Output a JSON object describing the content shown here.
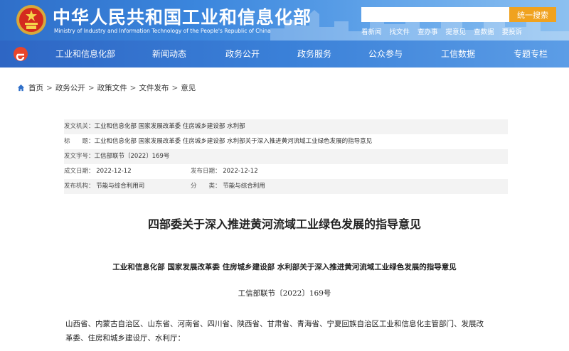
{
  "header": {
    "title": "中华人民共和国工业和信息化部",
    "subtitle": "Ministry of Industry and Information Technology of the People's Republic of China",
    "search_placeholder": "",
    "search_button": "统一搜索",
    "quick_links": [
      "看新闻",
      "找文件",
      "查办事",
      "提意见",
      "查数据",
      "要投诉"
    ]
  },
  "nav": {
    "items": [
      "工业和信息化部",
      "新闻动态",
      "政务公开",
      "政务服务",
      "公众参与",
      "工信数据",
      "专题专栏"
    ]
  },
  "breadcrumb": {
    "items": [
      "首页",
      "政务公开",
      "政策文件",
      "文件发布",
      "意见"
    ],
    "separator": ">"
  },
  "meta": {
    "issuer_label": "发文机关：",
    "issuer": "工业和信息化部 国家发展改革委 住房城乡建设部 水利部",
    "title_label": "标　　题：",
    "title": "工业和信息化部 国家发展改革委 住房城乡建设部 水利部关于深入推进黄河流域工业绿色发展的指导意见",
    "doc_no_label": "发文字号：",
    "doc_no": "工信部联节〔2022〕169号",
    "created_label": "成文日期：",
    "created": "2022-12-12",
    "published_label": "发布日期：",
    "published": "2022-12-12",
    "org_label": "发布机构：",
    "org": "节能与综合利用司",
    "category_label": "分　　类：",
    "category": "节能与综合利用"
  },
  "article": {
    "title": "四部委关于深入推进黄河流域工业绿色发展的指导意见",
    "heading": "工业和信息化部  国家发展改革委  住房城乡建设部  水利部关于深入推进黄河流域工业绿色发展的指导意见",
    "doc_number": "工信部联节〔2022〕169号",
    "body_lines": [
      "山西省、内蒙古自治区、山东省、河南省、四川省、陕西省、甘肃省、青海省、宁夏回族自治区工业和信息化主管部门、发展改",
      "革委、住房和城乡建设厅、水利厅："
    ]
  },
  "colors": {
    "header_blue": "#3b86dd",
    "search_button": "#f0a21f",
    "nav_blue": "#3a80d8",
    "meta_shade": "#f3f3f3"
  }
}
